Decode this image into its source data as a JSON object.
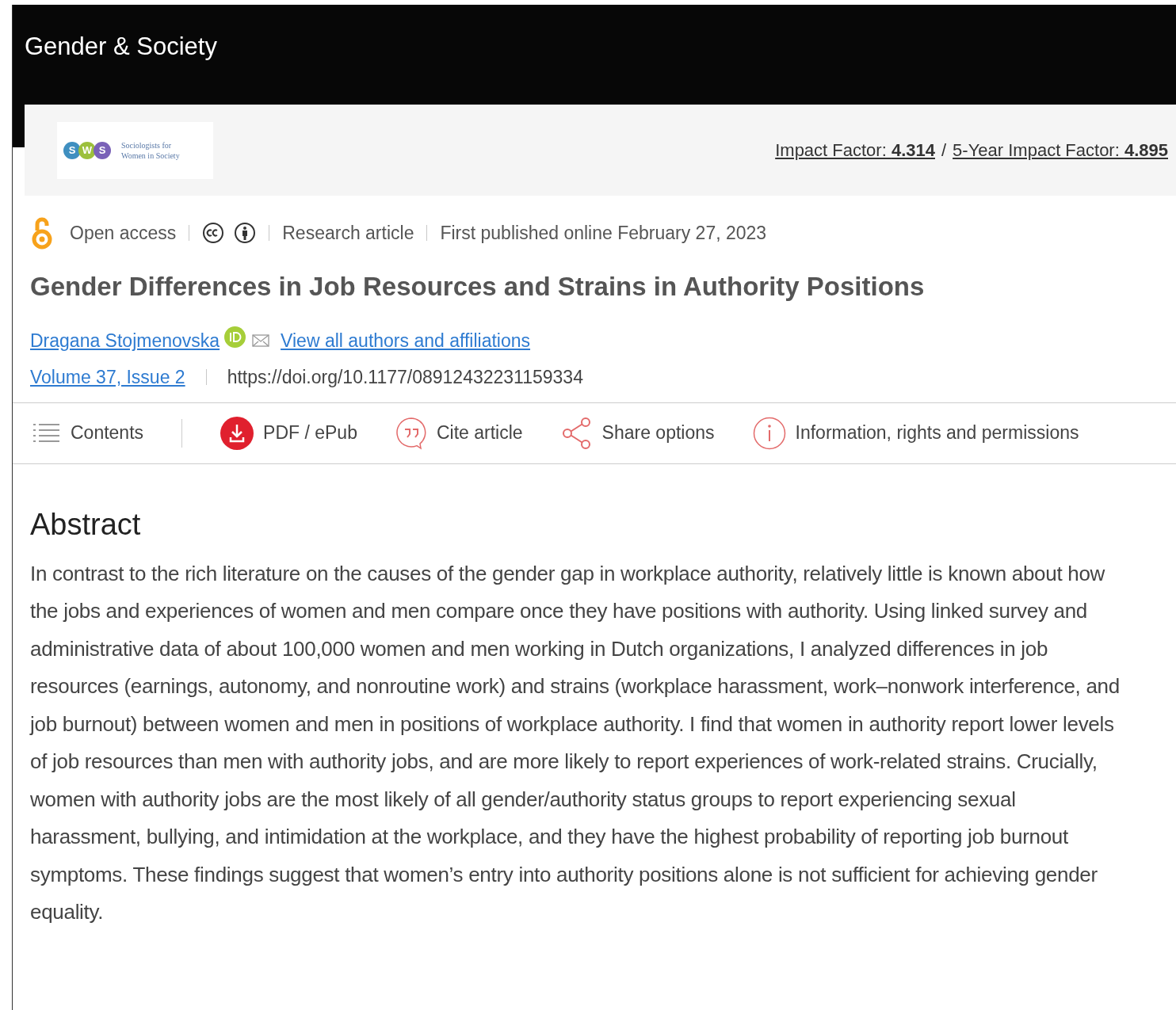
{
  "journal": {
    "title": "Gender & Society"
  },
  "society": {
    "logo_letters": [
      "S",
      "W",
      "S"
    ],
    "logo_lines": [
      "Sociologists for",
      "Women in Society"
    ],
    "impact_factor": "Impact Factor: **4.314**",
    "separator": "/",
    "five_year_impact_factor": "5-Year Impact Factor: **4.895**"
  },
  "meta": {
    "access": "Open access",
    "type": "Research article",
    "published": "First published online February 27, 2023"
  },
  "article": {
    "title": "Gender Differences in Job Resources and Strains in Authority Positions",
    "author": "Dragana Stojmenovska",
    "authors_link": "View all authors and affiliations",
    "issue": "Volume 37, Issue 2",
    "doi": "https://doi.org/10.1177/08912432231159334"
  },
  "toolbar": [
    {
      "kind": "contents",
      "label": "Contents"
    },
    {
      "kind": "pdf",
      "label": "PDF / ePub"
    },
    {
      "kind": "cite",
      "label": "Cite article"
    },
    {
      "kind": "share",
      "label": "Share options"
    },
    {
      "kind": "info",
      "label": "Information, rights and permissions"
    }
  ],
  "abstract": {
    "heading": "Abstract",
    "text": "In contrast to the rich literature on the causes of the gender gap in workplace authority, relatively little is known about how the jobs and experiences of women and men compare once they have positions with authority. Using linked survey and administrative data of about 100,000 women and men working in Dutch organizations, I analyzed differences in job resources (earnings, autonomy, and nonroutine work) and strains (workplace harassment, work–nonwork interference, and job burnout) between women and men in positions of workplace authority. I find that women in authority report lower levels of job resources than men with authority jobs, and are more likely to report experiences of work-related strains. Crucially, women with authority jobs are the most likely of all gender/authority status groups to report experiencing sexual harassment, bullying, and intimidation at the workplace, and they have the highest probability of reporting job burnout symptoms. These findings suggest that women’s entry into authority positions alone is not sufficient for achieving gender equality."
  }
}
